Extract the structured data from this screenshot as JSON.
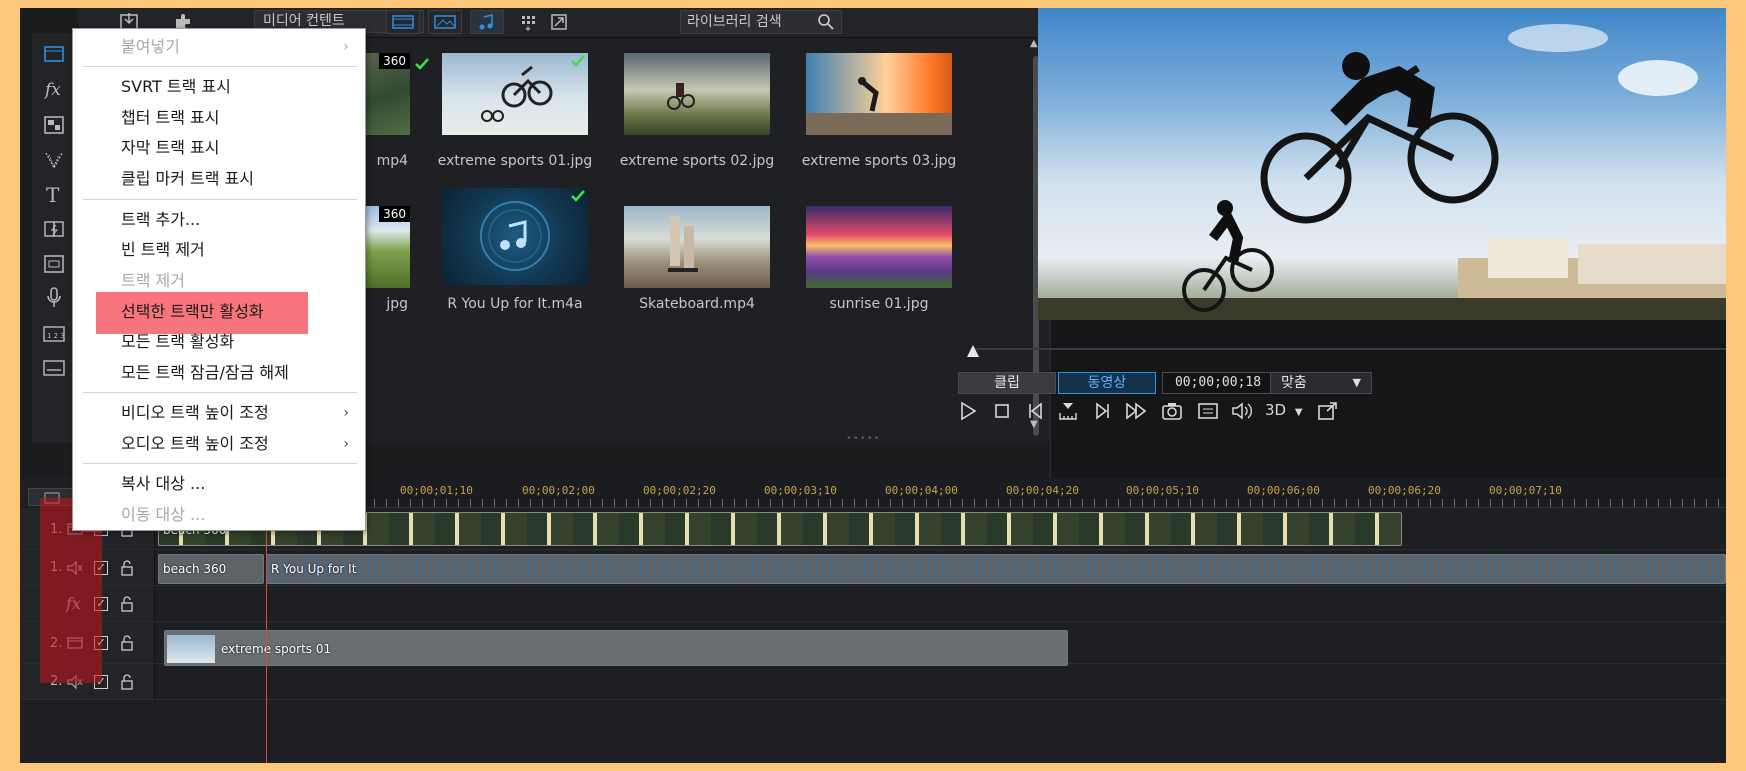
{
  "library": {
    "media_dropdown": "미디어 컨텐트",
    "search_placeholder": "라이브러리 검색",
    "items": [
      {
        "label": "mp4",
        "badge": "360",
        "checked": true
      },
      {
        "label": "extreme sports 01.jpg",
        "checked": true
      },
      {
        "label": "extreme sports 02.jpg"
      },
      {
        "label": "extreme sports 03.jpg"
      },
      {
        "label": "jpg",
        "badge": "360"
      },
      {
        "label": "R You Up for It.m4a",
        "checked": true
      },
      {
        "label": "Skateboard.mp4"
      },
      {
        "label": "sunrise 01.jpg"
      }
    ]
  },
  "context_menu": {
    "items": [
      {
        "label": "붙여넣기",
        "disabled": true,
        "submenu": true
      },
      {
        "label": "SVRT 트랙 표시"
      },
      {
        "label": "챕터 트랙 표시"
      },
      {
        "label": "자막 트랙 표시"
      },
      {
        "label": "클립 마커 트랙 표시"
      },
      {
        "label": "트랙 추가..."
      },
      {
        "label": "빈 트랙 제거"
      },
      {
        "label": "트랙 제거",
        "disabled": true
      },
      {
        "label": "선택한 트랙만 활성화",
        "highlighted": true
      },
      {
        "label": "모든 트랙 활성화"
      },
      {
        "label": "모든 트랙 잠금/잠금 해제"
      },
      {
        "label": "비디오 트랙 높이 조정",
        "submenu": true
      },
      {
        "label": "오디오 트랙 높이 조정",
        "submenu": true
      },
      {
        "label": "복사 대상 ..."
      },
      {
        "label": "이동 대상 ...",
        "disabled": true
      }
    ]
  },
  "preview": {
    "mode_clip": "클립",
    "mode_movie": "동영상",
    "timecode": "00;00;00;18",
    "fit": "맞춤",
    "threed": "3D"
  },
  "timeline": {
    "ruler_labels": [
      "00;00;01;10",
      "00;00;02;00",
      "00;00;02;20",
      "00;00;03;10",
      "00;00;04;00",
      "00;00;04;20",
      "00;00;05;10",
      "00;00;06;00",
      "00;00;06;20",
      "00;00;07;10"
    ],
    "tracks": [
      {
        "num": "1.",
        "kind": "video"
      },
      {
        "num": "1.",
        "kind": "audio"
      },
      {
        "num": "",
        "kind": "fx"
      },
      {
        "num": "2.",
        "kind": "video"
      },
      {
        "num": "2.",
        "kind": "audio"
      }
    ],
    "clips": {
      "video1": "beach 360",
      "audio1_a": "beach 360",
      "audio1_b": "R You Up for It",
      "video2": "extreme sports 01"
    }
  },
  "colors": {
    "accent": "#2f8fe0",
    "highlight": "#f7747d",
    "background": "#fdc87a"
  }
}
